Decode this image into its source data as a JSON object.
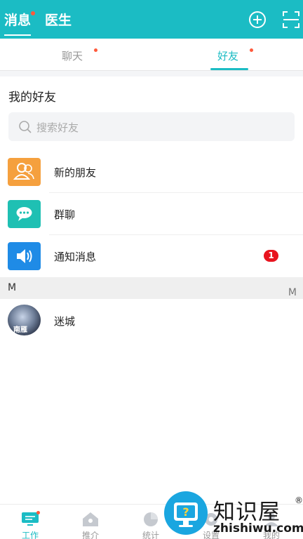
{
  "top_tabs": {
    "messages": "消息",
    "doctors": "医生"
  },
  "sub_tabs": {
    "chat": "聊天",
    "friends": "好友"
  },
  "section_title": "我的好友",
  "search": {
    "placeholder": "搜索好友"
  },
  "entries": [
    {
      "label": "新的朋友",
      "icon": "contacts-icon",
      "color": "#f5a03e"
    },
    {
      "label": "群聊",
      "icon": "chat-bubble-icon",
      "color": "#1fc0b3"
    },
    {
      "label": "通知消息",
      "icon": "speaker-icon",
      "color": "#1f8be6",
      "badge": "1"
    }
  ],
  "group": {
    "letter": "M",
    "index_letter": "M"
  },
  "friends": [
    {
      "name": "迷城",
      "avatar_text": "南雁"
    }
  ],
  "bottom_nav": [
    {
      "label": "工作",
      "icon": "monitor-icon",
      "active": true
    },
    {
      "label": "推介",
      "icon": "home-icon"
    },
    {
      "label": "统计",
      "icon": "pie-icon"
    },
    {
      "label": "设置",
      "icon": "settings-icon"
    },
    {
      "label": "我的",
      "icon": "user-icon"
    }
  ],
  "watermark": {
    "cn": "知识屋",
    "en": "zhishiwu.com",
    "reg": "®"
  },
  "colors": {
    "brand": "#1bbcc4",
    "dot": "#ff5a3c",
    "badge": "#e8141f"
  }
}
